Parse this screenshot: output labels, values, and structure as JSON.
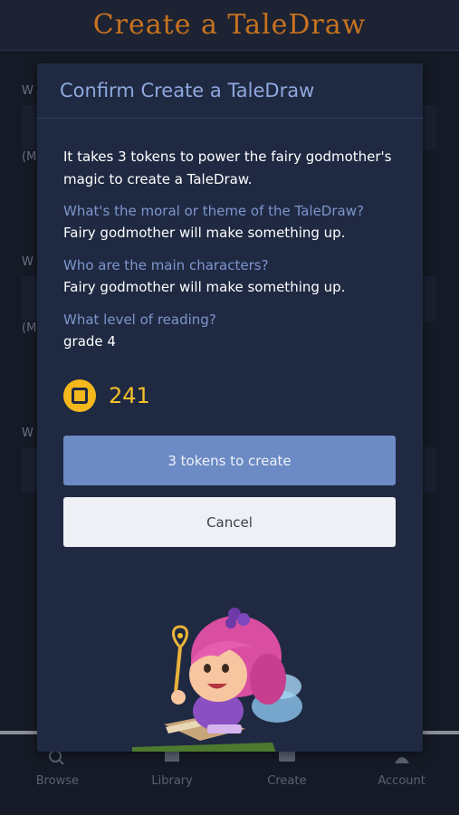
{
  "header": {
    "title": "Create a TaleDraw"
  },
  "background_form": {
    "labels": [
      "W",
      "(M",
      "W",
      "(M",
      "W"
    ]
  },
  "dialog": {
    "title": "Confirm Create a TaleDraw",
    "intro": "It takes 3 tokens to power the fairy godmother's magic to create a TaleDraw.",
    "questions": [
      {
        "q": "What's the moral or theme of the TaleDraw?",
        "a": "Fairy godmother will make something up."
      },
      {
        "q": "Who are the main characters?",
        "a": "Fairy godmother will make something up."
      },
      {
        "q": "What level of reading?",
        "a": "grade 4"
      }
    ],
    "token_balance": "241",
    "create_label": "3 tokens to create",
    "cancel_label": "Cancel"
  },
  "bottom_nav": [
    {
      "label": "Browse",
      "icon": "search-icon"
    },
    {
      "label": "Library",
      "icon": "book-icon"
    },
    {
      "label": "Create",
      "icon": "create-icon"
    },
    {
      "label": "Account",
      "icon": "user-icon"
    }
  ],
  "colors": {
    "accent": "#6c8ac4",
    "header_title": "#c8731f",
    "token": "#f4b81d",
    "dialog_bg": "#1f2942"
  }
}
